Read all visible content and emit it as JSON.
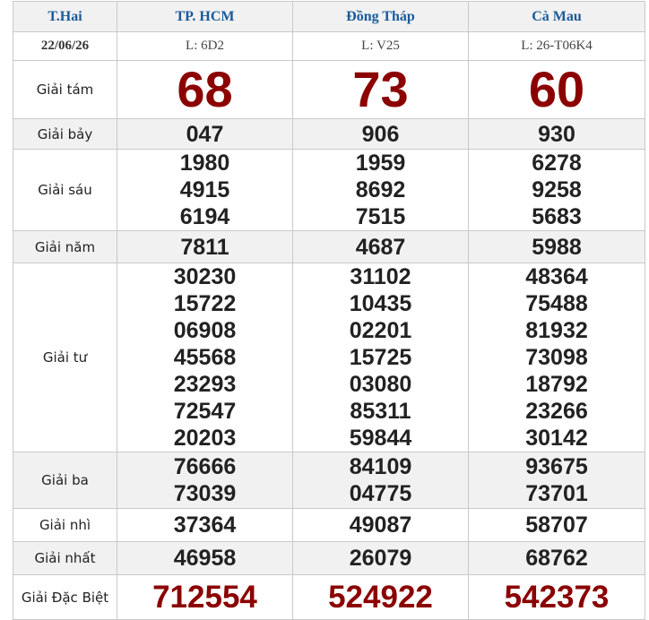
{
  "header": {
    "day": "T.Hai",
    "date": "22/06/26",
    "provinces": [
      {
        "name": "TP. HCM",
        "code": "L: 6D2"
      },
      {
        "name": "Đồng Tháp",
        "code": "L: V25"
      },
      {
        "name": "Cà Mau",
        "code": "L: 26-T06K4"
      }
    ]
  },
  "prizes": {
    "g8": {
      "label": "Giải tám",
      "values": [
        "68",
        "73",
        "60"
      ]
    },
    "g7": {
      "label": "Giải bảy",
      "values": [
        "047",
        "906",
        "930"
      ]
    },
    "g6": {
      "label": "Giải sáu",
      "values": [
        [
          "1980",
          "4915",
          "6194"
        ],
        [
          "1959",
          "8692",
          "7515"
        ],
        [
          "6278",
          "9258",
          "5683"
        ]
      ]
    },
    "g5": {
      "label": "Giải năm",
      "values": [
        "7811",
        "4687",
        "5988"
      ]
    },
    "g4": {
      "label": "Giải tư",
      "values": [
        [
          "30230",
          "15722",
          "06908",
          "45568",
          "23293",
          "72547",
          "20203"
        ],
        [
          "31102",
          "10435",
          "02201",
          "15725",
          "03080",
          "85311",
          "59844"
        ],
        [
          "48364",
          "75488",
          "81932",
          "73098",
          "18792",
          "23266",
          "30142"
        ]
      ]
    },
    "g3": {
      "label": "Giải ba",
      "values": [
        [
          "76666",
          "73039"
        ],
        [
          "84109",
          "04775"
        ],
        [
          "93675",
          "73701"
        ]
      ]
    },
    "g2": {
      "label": "Giải nhì",
      "values": [
        "37364",
        "49087",
        "58707"
      ]
    },
    "g1": {
      "label": "Giải nhất",
      "values": [
        "46958",
        "26079",
        "68762"
      ]
    },
    "db": {
      "label": "Giải Đặc Biệt",
      "values": [
        "712554",
        "524922",
        "542373"
      ]
    }
  }
}
